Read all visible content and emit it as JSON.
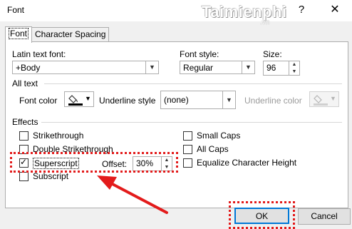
{
  "window": {
    "title": "Font",
    "help_label": "?",
    "close_label": "✕"
  },
  "watermark": {
    "brand_first": "T",
    "brand_rest": "aimienphi",
    "brand_sub": ".vn"
  },
  "tabs": [
    {
      "label": "Font",
      "active": true
    },
    {
      "label": "Character Spacing",
      "active": false
    }
  ],
  "latin_font": {
    "label": "Latin text font:",
    "value": "+Body"
  },
  "font_style": {
    "label": "Font style:",
    "value": "Regular"
  },
  "size": {
    "label": "Size:",
    "value": "96"
  },
  "all_text": {
    "heading": "All text",
    "font_color_label": "Font color",
    "underline_style_label": "Underline style",
    "underline_style_value": "(none)",
    "underline_color_label": "Underline color"
  },
  "effects": {
    "heading": "Effects",
    "strikethrough": {
      "label": "Strikethrough",
      "checked": false
    },
    "double_strikethrough": {
      "label": "Double Strikethrough",
      "checked": false
    },
    "superscript": {
      "label": "Superscript",
      "checked": true
    },
    "offset_label": "Offset:",
    "offset_value": "30%",
    "subscript": {
      "label": "Subscript",
      "checked": false
    },
    "small_caps": {
      "label": "Small Caps",
      "checked": false
    },
    "all_caps": {
      "label": "All Caps",
      "checked": false
    },
    "equalize": {
      "label": "Equalize Character Height",
      "checked": false
    }
  },
  "buttons": {
    "ok": "OK",
    "cancel": "Cancel"
  },
  "colors": {
    "highlight": "#e31b1b",
    "ok_border": "#0078d7"
  }
}
